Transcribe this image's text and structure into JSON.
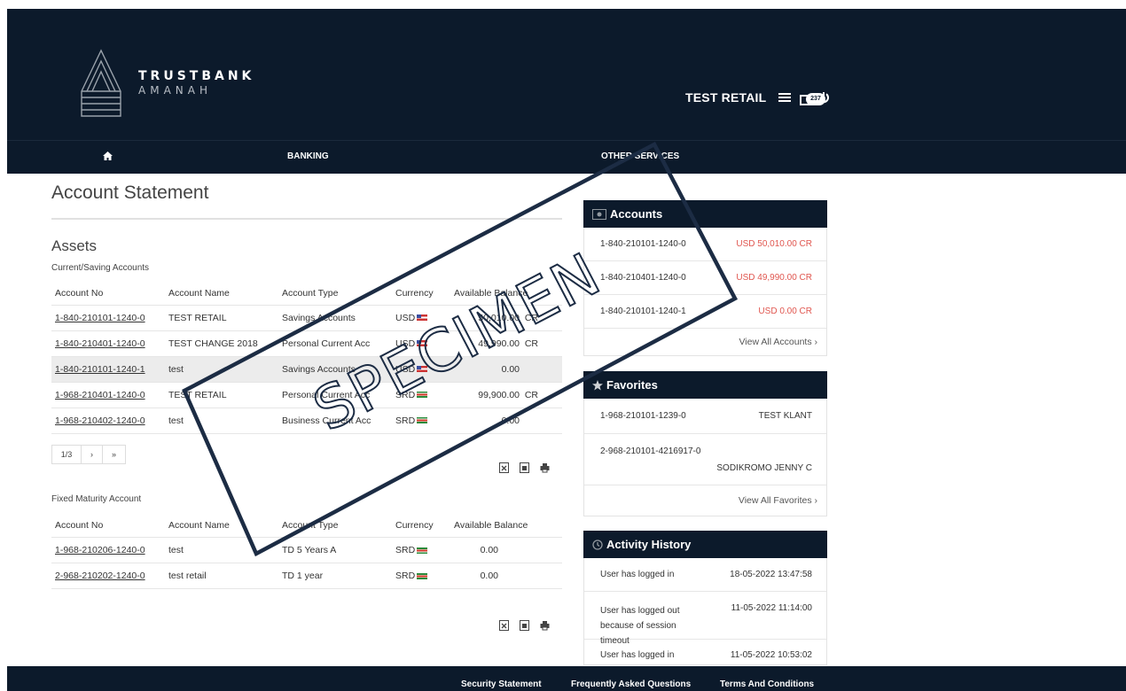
{
  "brand": {
    "line1": "TRUSTBANK",
    "line2": "AMANAH"
  },
  "header": {
    "user_name": "TEST RETAIL",
    "mail_badge": "237"
  },
  "nav": {
    "home_icon": "home-icon",
    "banking": "BANKING",
    "other_services": "OTHER SERVICES"
  },
  "page": {
    "title": "Account Statement",
    "assets_title": "Assets",
    "current_saving_title": "Current/Saving Accounts",
    "fixed_title": "Fixed Maturity Account"
  },
  "table_headers": [
    "Account No",
    "Account Name",
    "Account Type",
    "Currency",
    "Available Balance"
  ],
  "current_accounts": [
    {
      "no": "1-840-210101-1240-0",
      "name": "TEST RETAIL",
      "type": "Savings Accounts",
      "currency": "USD",
      "balance": "50,010.00",
      "suffix": "CR"
    },
    {
      "no": "1-840-210401-1240-0",
      "name": "TEST CHANGE 2018",
      "type": "Personal Current Acc",
      "currency": "USD",
      "balance": "49,990.00",
      "suffix": "CR"
    },
    {
      "no": "1-840-210101-1240-1",
      "name": "test",
      "type": "Savings Accounts",
      "currency": "USD",
      "balance": "0.00",
      "suffix": ""
    },
    {
      "no": "1-968-210401-1240-0",
      "name": "TEST RETAIL",
      "type": "Personal Current Acc",
      "currency": "SRD",
      "balance": "99,900.00",
      "suffix": "CR"
    },
    {
      "no": "1-968-210402-1240-0",
      "name": "test",
      "type": "Business Current Acc",
      "currency": "SRD",
      "balance": "0.00",
      "suffix": ""
    }
  ],
  "pager": {
    "page": "1/3",
    "next": "›",
    "last": "»"
  },
  "fixed_accounts": [
    {
      "no": "1-968-210206-1240-0",
      "name": "test",
      "type": "TD 5 Years A",
      "currency": "SRD",
      "balance": "0.00"
    },
    {
      "no": "2-968-210202-1240-0",
      "name": "test retail",
      "type": "TD 1 year",
      "currency": "SRD",
      "balance": "0.00"
    }
  ],
  "accounts_panel": {
    "title": "Accounts",
    "items": [
      {
        "no": "1-840-210101-1240-0",
        "amount": "USD 50,010.00 CR"
      },
      {
        "no": "1-840-210401-1240-0",
        "amount": "USD 49,990.00 CR"
      },
      {
        "no": "1-840-210101-1240-1",
        "amount": "USD 0.00 CR"
      }
    ],
    "view_all": "View All Accounts ›"
  },
  "favorites_panel": {
    "title": "Favorites",
    "items": [
      {
        "no": "1-968-210101-1239-0",
        "name": "TEST KLANT"
      },
      {
        "no": "2-968-210101-4216917-0",
        "name": "SODIKROMO JENNY C"
      }
    ],
    "view_all": "View All Favorites ›"
  },
  "activity_panel": {
    "title": "Activity History",
    "items": [
      {
        "text": "User has logged in",
        "time": "18-05-2022 13:47:58"
      },
      {
        "text": "User has logged out because of session timeout",
        "time": "11-05-2022 11:14:00"
      },
      {
        "text": "User has logged in",
        "time": "11-05-2022 10:53:02"
      }
    ]
  },
  "footer": {
    "security": "Security Statement",
    "faq": "Frequently Asked Questions",
    "terms": "Terms And Conditions"
  },
  "watermark": "SPECIMEN",
  "colors": {
    "navy": "#0c1a2b",
    "red_amount": "#e0564f"
  }
}
